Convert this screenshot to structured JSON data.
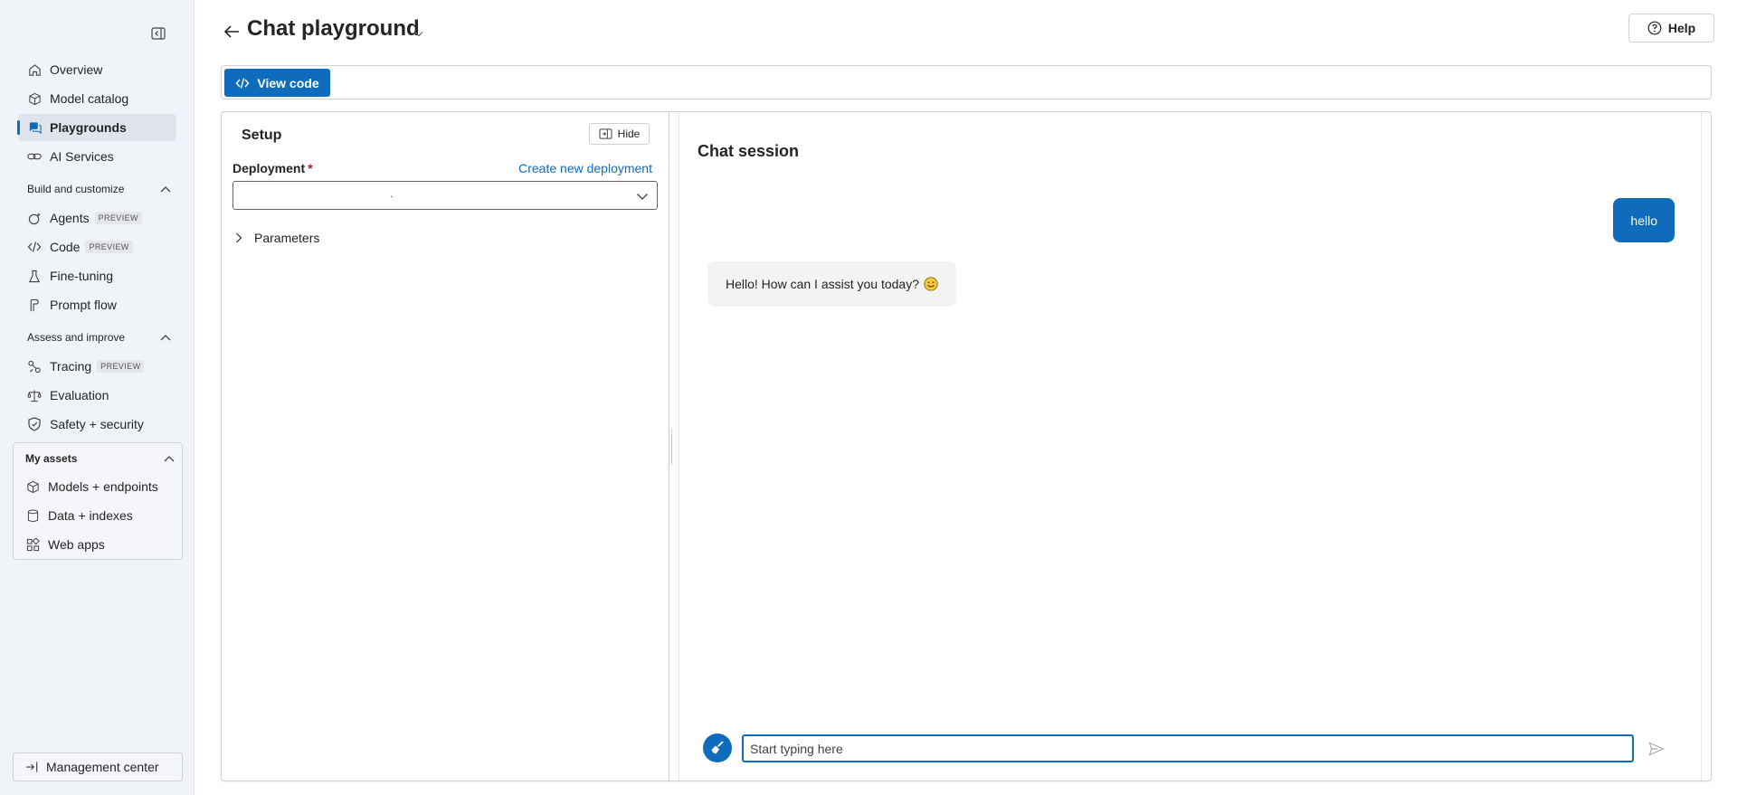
{
  "sidebar": {
    "collapse_icon": "panel-collapse-icon",
    "items": [
      {
        "label": "Overview",
        "icon": "home-icon"
      },
      {
        "label": "Model catalog",
        "icon": "cube-catalog-icon"
      },
      {
        "label": "Playgrounds",
        "icon": "chat-bubbles-icon",
        "active": true
      },
      {
        "label": "AI Services",
        "icon": "link-icon"
      }
    ],
    "build_section": {
      "title": "Build and customize",
      "items": [
        {
          "label": "Agents",
          "badge": "PREVIEW",
          "icon": "sparkle-icon"
        },
        {
          "label": "Code",
          "badge": "PREVIEW",
          "icon": "code-icon"
        },
        {
          "label": "Fine-tuning",
          "icon": "beaker-icon"
        },
        {
          "label": "Prompt flow",
          "icon": "flow-icon"
        }
      ]
    },
    "assess_section": {
      "title": "Assess and improve",
      "items": [
        {
          "label": "Tracing",
          "badge": "PREVIEW",
          "icon": "tracing-icon"
        },
        {
          "label": "Evaluation",
          "icon": "scale-icon"
        },
        {
          "label": "Safety + security",
          "icon": "shield-icon"
        }
      ]
    },
    "assets_section": {
      "title": "My assets",
      "items": [
        {
          "label": "Models + endpoints",
          "icon": "cube-icon"
        },
        {
          "label": "Data + indexes",
          "icon": "database-icon"
        },
        {
          "label": "Web apps",
          "icon": "apps-icon"
        }
      ]
    },
    "management": {
      "label": "Management center",
      "icon": "arrow-exit-icon"
    }
  },
  "header": {
    "title": "Chat playground",
    "help_label": "Help"
  },
  "toolbar": {
    "view_code_label": "View code"
  },
  "setup": {
    "title": "Setup",
    "hide_label": "Hide",
    "deployment_label": "Deployment",
    "required_marker": "*",
    "create_link": "Create new deployment",
    "deployment_value": ".",
    "parameters_label": "Parameters"
  },
  "chat": {
    "title": "Chat session",
    "messages": [
      {
        "role": "user",
        "text": "hello"
      },
      {
        "role": "assistant",
        "text": "Hello! How can I assist you today?",
        "emoji": "smile-emoji-icon"
      }
    ],
    "input_placeholder": "Start typing here"
  },
  "colors": {
    "accent": "#0f6cbd",
    "sidebar_bg": "#f0f3f8",
    "required": "#c50f1f",
    "bot_bubble": "#f3f3f3"
  }
}
